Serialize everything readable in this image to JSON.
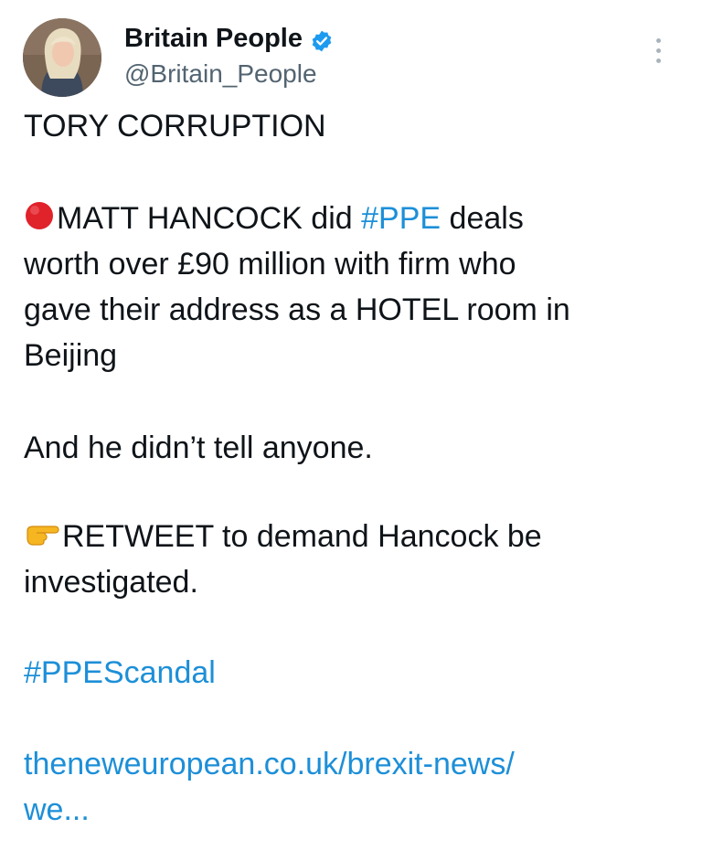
{
  "author": {
    "name": "Britain People",
    "handle": "@Britain_People",
    "verified_icon": "verified-badge-icon",
    "avatar_icon": "avatar"
  },
  "menu": {
    "icon": "more-options-icon"
  },
  "tweet": {
    "title": "TORY CORRUPTION",
    "l1_pre": "MATT HANCOCK did ",
    "l1_tag": "#PPE",
    "l1_post": " deals",
    "l2": "worth over £90 million with firm who",
    "l3": "gave their address as a HOTEL room in",
    "l4": "Beijing",
    "l5": "And he didn’t tell anyone.",
    "l6": "RETWEET to demand Hancock be",
    "l7": "investigated.",
    "hashtag": "#PPEScandal",
    "link_line1": "theneweuropean.co.uk/brexit-news/",
    "link_line2": "we..."
  },
  "colors": {
    "link": "#1d8fd8",
    "handle": "#536471",
    "badge": "#1d9bf0",
    "red_circle": "#e0222b"
  },
  "emoji": {
    "bullet": "red-circle-icon",
    "pointer": "pointing-hand-icon"
  }
}
